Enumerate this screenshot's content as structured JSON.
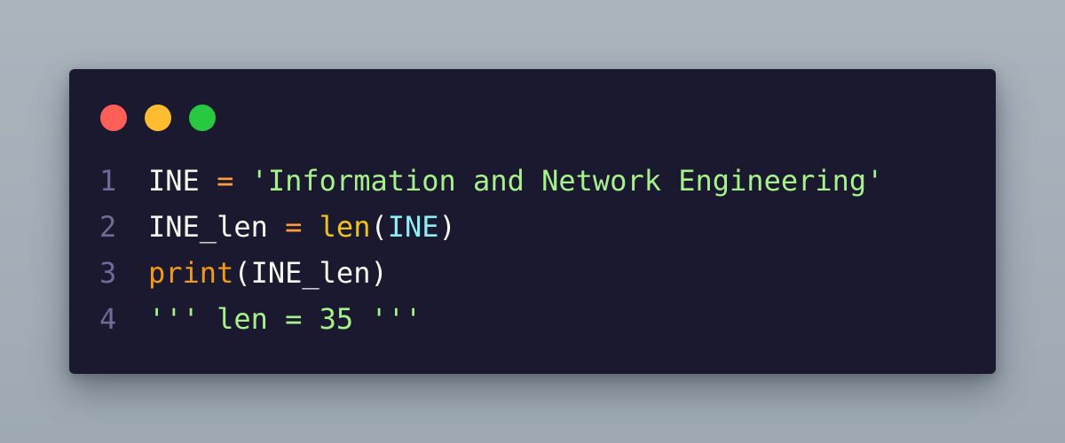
{
  "traffic_lights": {
    "close_color": "#ff5f57",
    "minimize_color": "#febc2e",
    "maximize_color": "#28c840"
  },
  "colors": {
    "background": "#1a1930",
    "line_number": "#6f6b98",
    "default_text": "#f8f8f2",
    "operator": "#ff9d3b",
    "string": "#a6f18a",
    "builtin_len": "#f2c214",
    "builtin_print": "#f29a13",
    "argument": "#8fedf3"
  },
  "code": {
    "lines": [
      {
        "number": "1",
        "tokens": {
          "var": "INE",
          "sp1": " ",
          "op": "=",
          "sp2": " ",
          "str": "'Information and Network Engineering'"
        }
      },
      {
        "number": "2",
        "tokens": {
          "var": "INE_len",
          "sp1": " ",
          "op": "=",
          "sp2": " ",
          "fn": "len",
          "lparen": "(",
          "arg": "INE",
          "rparen": ")"
        }
      },
      {
        "number": "3",
        "tokens": {
          "fn": "print",
          "lparen": "(",
          "arg": "INE_len",
          "rparen": ")"
        }
      },
      {
        "number": "4",
        "tokens": {
          "str": "''' len = 35 '''"
        }
      }
    ]
  }
}
